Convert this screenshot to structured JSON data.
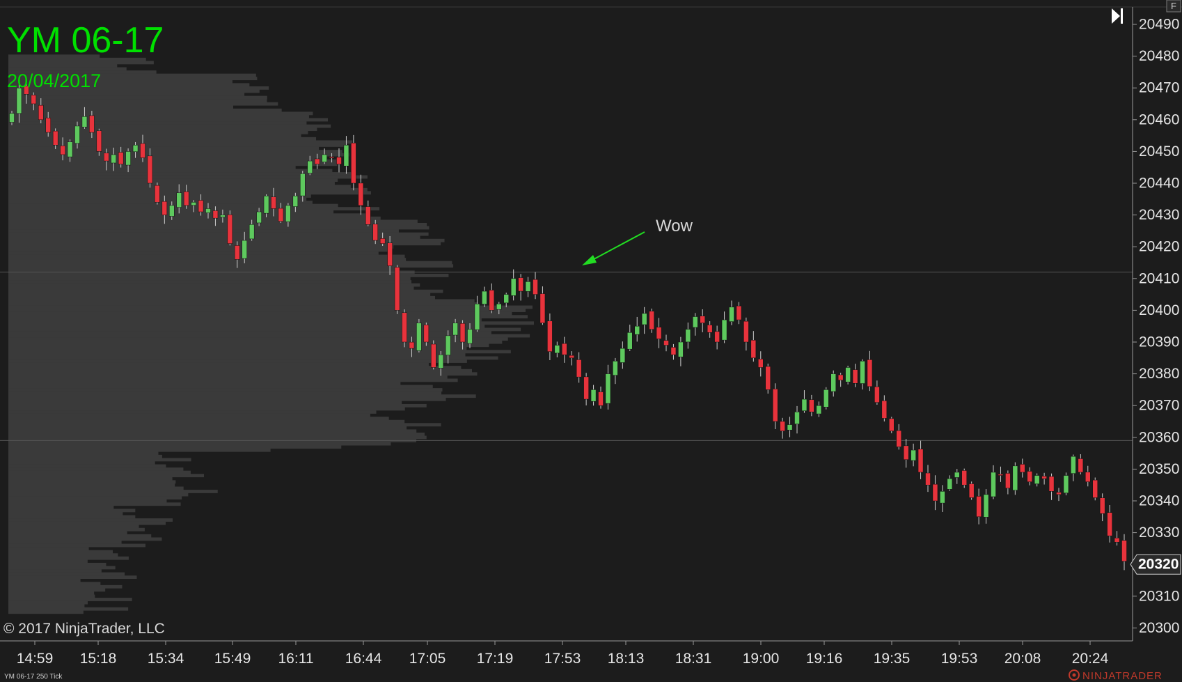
{
  "instrument": {
    "symbol": "YM 06-17",
    "date": "20/04/2017"
  },
  "copyright": "© 2017 NinjaTrader, LLC",
  "series_caption": "YM 06-17 250 Tick",
  "brand": "NINJATRADER",
  "corner_button": "F",
  "annotation": {
    "text": "Wow",
    "color": "#22dd22"
  },
  "colors": {
    "background": "#1c1c1c",
    "up_candle": "#5ec95e",
    "down_candle": "#e8333c",
    "wick": "#cfcfcf",
    "volume_profile": "#3a3a3a",
    "title": "#00e000",
    "axis_text": "#e6e6e6",
    "price_marker_bg": "#2a2a2a"
  },
  "chart_data": {
    "type": "candlestick",
    "ylim": [
      20297,
      20495
    ],
    "y_ticks": [
      20300,
      20310,
      20320,
      20330,
      20340,
      20350,
      20360,
      20370,
      20380,
      20390,
      20400,
      20410,
      20420,
      20430,
      20440,
      20450,
      20460,
      20470,
      20480,
      20490
    ],
    "x_ticks": [
      "14:59",
      "15:18",
      "15:34",
      "15:49",
      "16:11",
      "16:44",
      "17:05",
      "17:19",
      "17:53",
      "18:13",
      "18:31",
      "19:00",
      "19:16",
      "19:35",
      "19:53",
      "20:08",
      "20:24"
    ],
    "last_price": 20320,
    "reference_lines": [
      20412,
      20359
    ],
    "candle_close_path": [
      20462,
      20470,
      20468,
      20465,
      20460,
      20456,
      20452,
      20449,
      20453,
      20458,
      20461,
      20456,
      20450,
      20447,
      20449,
      20446,
      20450,
      20452,
      20448,
      20440,
      20434,
      20430,
      20433,
      20437,
      20433,
      20434,
      20431,
      20432,
      20429,
      20430,
      20421,
      20416,
      20422,
      20427,
      20431,
      20436,
      20432,
      20428,
      20433,
      20436,
      20443,
      20447,
      20446,
      20449,
      20448,
      20446,
      20452,
      20440,
      20433,
      20427,
      20422,
      20421,
      20414,
      20400,
      20390,
      20388,
      20396,
      20390,
      20382,
      20386,
      20392,
      20396,
      20390,
      20394,
      20402,
      20406,
      20400,
      20402,
      20405,
      20410,
      20406,
      20409,
      20405,
      20396,
      20387,
      20389,
      20386,
      20385,
      20379,
      20372,
      20375,
      20370,
      20380,
      20384,
      20388,
      20393,
      20395,
      20399,
      20394,
      20391,
      20389,
      20386,
      20390,
      20394,
      20398,
      20396,
      20393,
      20390,
      20397,
      20401,
      20397,
      20390,
      20385,
      20382,
      20375,
      20365,
      20362,
      20364,
      20368,
      20372,
      20368,
      20370,
      20375,
      20380,
      20378,
      20382,
      20377,
      20384,
      20376,
      20371,
      20366,
      20362,
      20357,
      20353,
      20356,
      20349,
      20345,
      20340,
      20343,
      20347,
      20349,
      20345,
      20341,
      20335,
      20342,
      20349,
      20348,
      20344,
      20351,
      20349,
      20346,
      20348,
      20347,
      20343,
      20342,
      20348,
      20354,
      20349,
      20346,
      20341,
      20336,
      20329,
      20327,
      20321
    ]
  }
}
